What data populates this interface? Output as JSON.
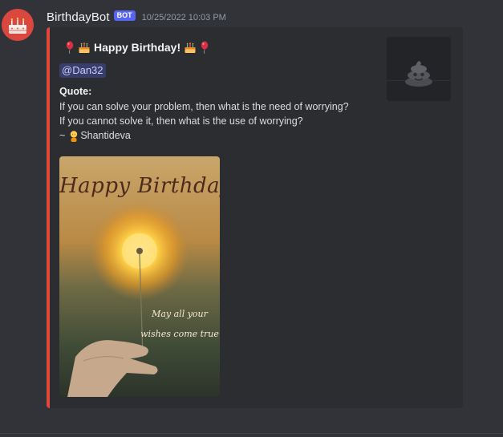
{
  "message": {
    "username": "BirthdayBot",
    "bot_tag": "BOT",
    "timestamp": "10/25/2022 10:03 PM",
    "avatar_icon": "birthday-cake-icon"
  },
  "embed": {
    "accent_color": "#e0483b",
    "title": "Happy Birthday!",
    "title_emojis": [
      "balloon-icon",
      "birthday-cake-icon",
      "birthday-cake-icon",
      "balloon-icon"
    ],
    "mention": "@Dan32",
    "quote_label": "Quote:",
    "quote_lines": [
      "If you can solve your problem, then what is the need of worrying?",
      "If you cannot solve it, then what is the use of worrying?"
    ],
    "author_prefix": "~",
    "author_emoji": "old-man-icon",
    "author": "Shantideva",
    "thumbnail_icon": "pile-of-poo-icon",
    "image": {
      "title": "Happy Birthday",
      "wish_line1": "May all your",
      "wish_line2": "wishes come true"
    }
  },
  "colors": {
    "background": "#313338",
    "embed_background": "#2b2d31",
    "bot_tag": "#5865f2",
    "mention_text": "#c9cdfb"
  }
}
